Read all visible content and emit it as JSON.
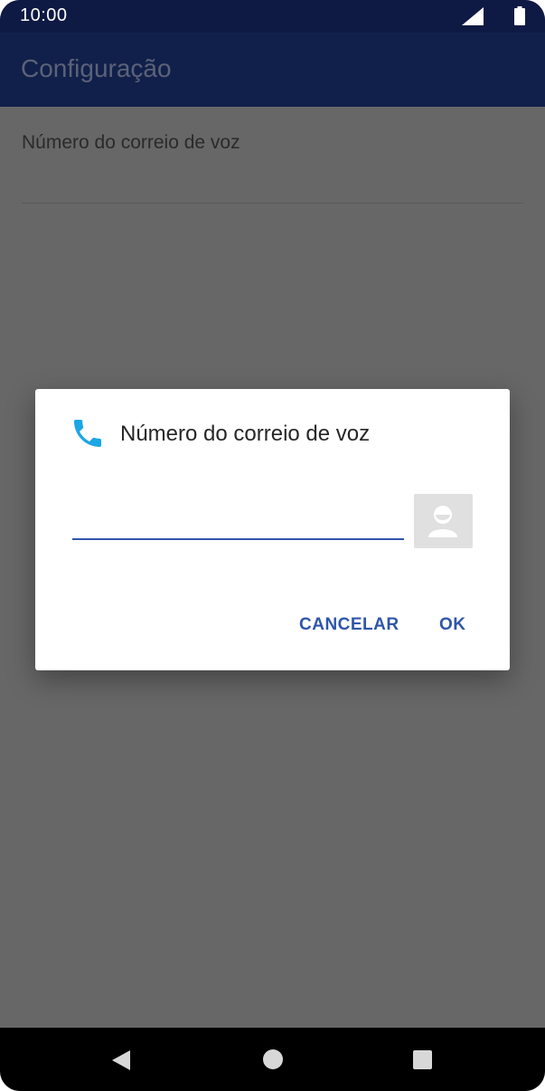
{
  "status_bar": {
    "time": "10:00",
    "icons": [
      "signal-icon",
      "battery-icon"
    ]
  },
  "app_bar": {
    "title": "Configuração"
  },
  "settings": {
    "items": [
      {
        "label": "Número do correio de voz"
      }
    ]
  },
  "dialog": {
    "icon": "phone-icon",
    "title": "Número do correio de voz",
    "input_value": "",
    "contact_picker_icon": "contact-picker-icon",
    "cancel_label": "CANCELAR",
    "ok_label": "OK"
  },
  "nav_bar": {
    "icons": [
      "back-icon",
      "home-icon",
      "recents-icon"
    ]
  },
  "colors": {
    "status_bar": "#0e1a44",
    "app_bar": "#11204a",
    "scrim_background": "#676767",
    "accent": "#2f56a9",
    "phone_icon": "#1ba6e4"
  }
}
